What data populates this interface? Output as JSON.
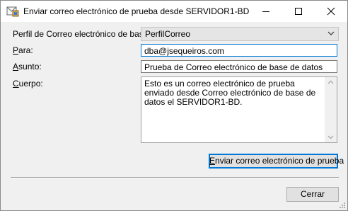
{
  "window": {
    "title": "Enviar correo electrónico de prueba desde SERVIDOR1-BD"
  },
  "form": {
    "profile": {
      "label": "Perfil de Correo electrónico de base",
      "value": "PerfilCorreo"
    },
    "to": {
      "label_first": "P",
      "label_rest": "ara:",
      "value": "dba@jsequeiros.com"
    },
    "subject": {
      "label_first": "A",
      "label_rest": "sunto:",
      "value": "Prueba de Correo electrónico de base de datos"
    },
    "body": {
      "label_first": "C",
      "label_rest": "uerpo:",
      "value": "Esto es un correo electrónico de prueba enviado desde Correo electrónico de base de datos el SERVIDOR1-BD."
    }
  },
  "buttons": {
    "send_first": "E",
    "send_rest": "nviar correo electrónico de prueba",
    "close": "Cerrar"
  }
}
